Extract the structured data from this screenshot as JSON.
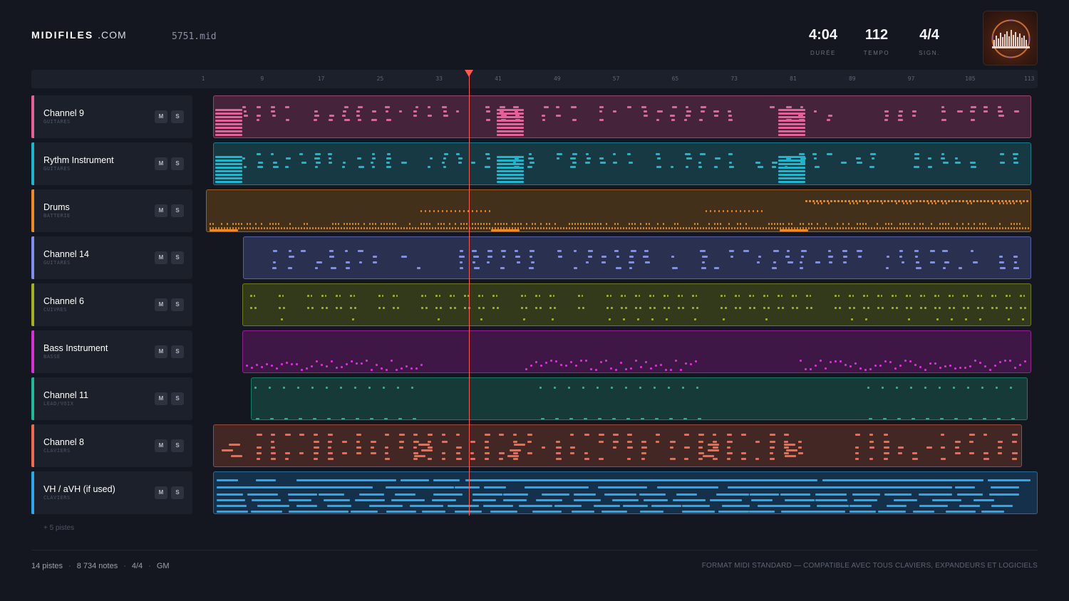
{
  "brand": {
    "name": "MIDIFILES",
    "suffix": ".COM"
  },
  "file": {
    "name": "5751.mid"
  },
  "stats": [
    {
      "value": "4:04",
      "label": "DURÉE"
    },
    {
      "value": "112",
      "label": "TEMPO"
    },
    {
      "value": "4/4",
      "label": "SIGN."
    }
  ],
  "ruler": {
    "ticks": [
      "1",
      "9",
      "17",
      "25",
      "33",
      "41",
      "49",
      "57",
      "65",
      "73",
      "81",
      "89",
      "97",
      "105",
      "113"
    ]
  },
  "playhead": {
    "bar": 37
  },
  "tracks": [
    {
      "name": "Channel 9",
      "category": "GUITARES",
      "color": "#e8609a",
      "bg": "#45233a",
      "mute": "M",
      "solo": "S"
    },
    {
      "name": "Rythm Instrument",
      "category": "GUITARES",
      "color": "#1fb5cf",
      "bg": "#163944",
      "mute": "M",
      "solo": "S"
    },
    {
      "name": "Drums",
      "category": "BATTERIE",
      "color": "#f08a24",
      "bg": "#43301a",
      "mute": "M",
      "solo": "S"
    },
    {
      "name": "Channel 14",
      "category": "GUITARES",
      "color": "#7f8ff0",
      "bg": "#2a3150",
      "mute": "M",
      "solo": "S"
    },
    {
      "name": "Channel 6",
      "category": "CUIVRES",
      "color": "#a3b020",
      "bg": "#333a1c",
      "mute": "M",
      "solo": "S"
    },
    {
      "name": "Bass Instrument",
      "category": "BASSE",
      "color": "#d92fd6",
      "bg": "#3f1747",
      "mute": "M",
      "solo": "S"
    },
    {
      "name": "Channel 11",
      "category": "LEAD/VOIX",
      "color": "#1fb89a",
      "bg": "#153a38",
      "mute": "M",
      "solo": "S"
    },
    {
      "name": "Channel 8",
      "category": "CLAVIERS",
      "color": "#ee6a50",
      "bg": "#432724",
      "mute": "M",
      "solo": "S"
    },
    {
      "name": "VH / aVH (if used)",
      "category": "CLAVIERS",
      "color": "#2aa8ee",
      "bg": "#15304a",
      "mute": "M",
      "solo": "S"
    }
  ],
  "more_tracks": "+ 5 pistes",
  "footer": {
    "tracks": "14 pistes",
    "notes": "8 734 notes",
    "signature": "4/4",
    "standard": "GM",
    "tagline": "FORMAT MIDI STANDARD — COMPATIBLE AVEC TOUS CLAVIERS, EXPANDEURS ET LOGICIELS"
  }
}
